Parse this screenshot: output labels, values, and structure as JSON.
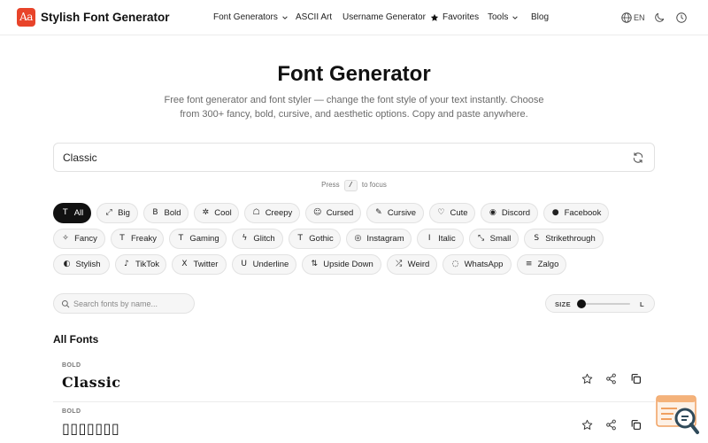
{
  "header": {
    "logo_glyph": "Aa",
    "brand": "Stylish Font Generator",
    "nav": {
      "font_generators": "Font Generators",
      "ascii_art": "ASCII Art",
      "username_generator": "Username Generator",
      "favorites": "Favorites",
      "tools": "Tools",
      "blog": "Blog"
    },
    "language": "EN",
    "icons": [
      "globe-icon",
      "moon-icon",
      "clock-icon"
    ]
  },
  "hero": {
    "title": "Font Generator",
    "subtitle": "Free font generator and font styler — change the font style of your text instantly. Choose from 300+ fancy, bold, cursive, and aesthetic options. Copy and paste anywhere."
  },
  "input": {
    "value": "Classic",
    "hint_before": "Press",
    "hint_key": "/",
    "hint_after": "to focus"
  },
  "chips": [
    {
      "label": "All",
      "icon": "T",
      "active": true
    },
    {
      "label": "Big",
      "icon": "⤢"
    },
    {
      "label": "Bold",
      "icon": "B"
    },
    {
      "label": "Cool",
      "icon": "✲"
    },
    {
      "label": "Creepy",
      "icon": "☖"
    },
    {
      "label": "Cursed",
      "icon": "☺"
    },
    {
      "label": "Cursive",
      "icon": "✎"
    },
    {
      "label": "Cute",
      "icon": "♡"
    },
    {
      "label": "Discord",
      "icon": "◉"
    },
    {
      "label": "Facebook",
      "icon": "●"
    },
    {
      "label": "Fancy",
      "icon": "✧"
    },
    {
      "label": "Freaky",
      "icon": "T"
    },
    {
      "label": "Gaming",
      "icon": "T"
    },
    {
      "label": "Glitch",
      "icon": "ϟ"
    },
    {
      "label": "Gothic",
      "icon": "T"
    },
    {
      "label": "Instagram",
      "icon": "◎"
    },
    {
      "label": "Italic",
      "icon": "I"
    },
    {
      "label": "Small",
      "icon": "⤡"
    },
    {
      "label": "Strikethrough",
      "icon": "S"
    },
    {
      "label": "Stylish",
      "icon": "◐"
    },
    {
      "label": "TikTok",
      "icon": "♪"
    },
    {
      "label": "Twitter",
      "icon": "X"
    },
    {
      "label": "Underline",
      "icon": "U"
    },
    {
      "label": "Upside Down",
      "icon": "⇅"
    },
    {
      "label": "Weird",
      "icon": "⤮"
    },
    {
      "label": "WhatsApp",
      "icon": "◌"
    },
    {
      "label": "Zalgo",
      "icon": "≡"
    }
  ],
  "search": {
    "placeholder": "Search fonts by name..."
  },
  "size_control": {
    "label": "SIZE",
    "max_label": "L",
    "level": 0
  },
  "list": {
    "title": "All Fonts",
    "rows": [
      {
        "category": "BOLD",
        "sample": "Classic"
      },
      {
        "category": "BOLD",
        "sample": "▯▯▯▯▯▯▯"
      }
    ]
  }
}
